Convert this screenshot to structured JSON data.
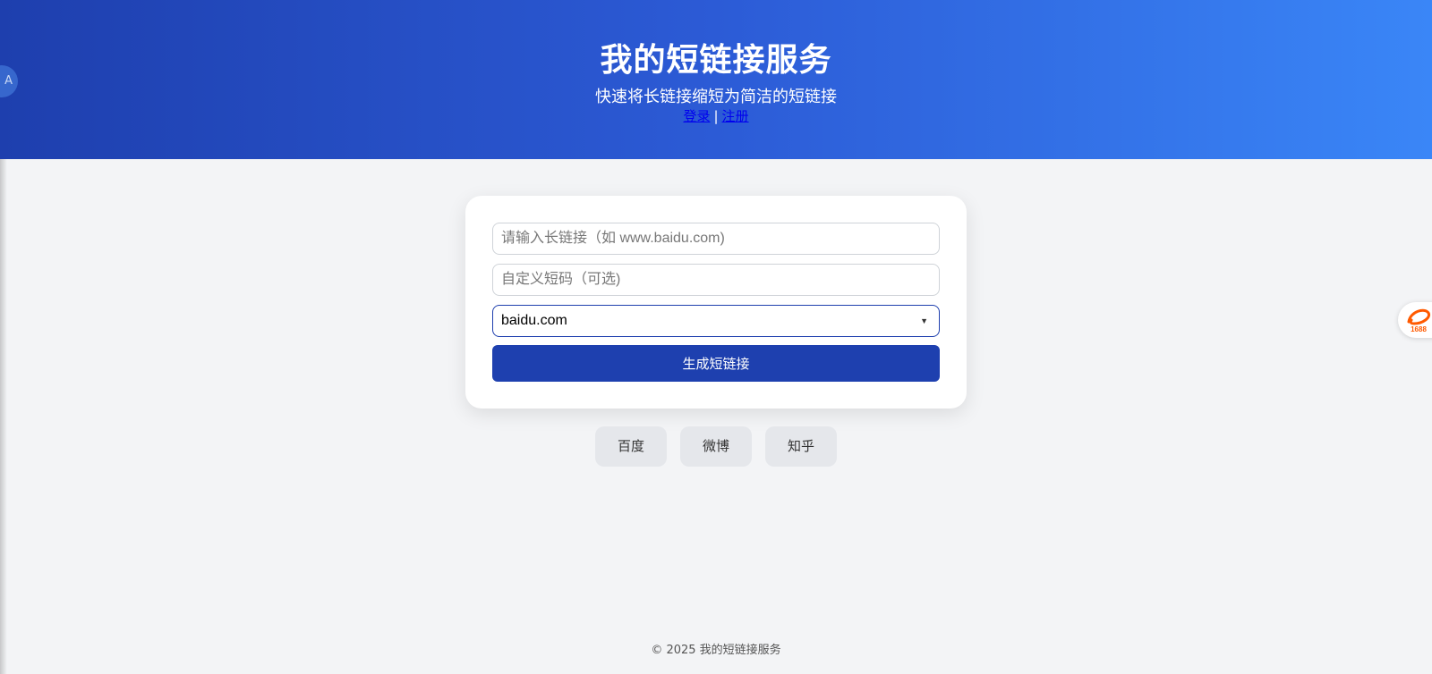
{
  "header": {
    "title": "我的短链接服务",
    "subtitle": "快速将长链接缩短为简洁的短链接",
    "login_label": "登录",
    "separator": "|",
    "register_label": "注册"
  },
  "form": {
    "long_url_placeholder": "请输入长链接（如 www.baidu.com)",
    "custom_code_placeholder": "自定义短码（可选)",
    "domain_selected": "baidu.com",
    "submit_label": "生成短链接"
  },
  "quick_links": [
    "百度",
    "微博",
    "知乎"
  ],
  "footer": {
    "text": "© 2025 我的短链接服务"
  },
  "side_badge": {
    "label": "1688"
  },
  "colors": {
    "header_gradient_start": "#1e3fae",
    "header_gradient_end": "#3a86f7",
    "primary_button": "#1e40af",
    "page_background": "#f3f4f6"
  }
}
